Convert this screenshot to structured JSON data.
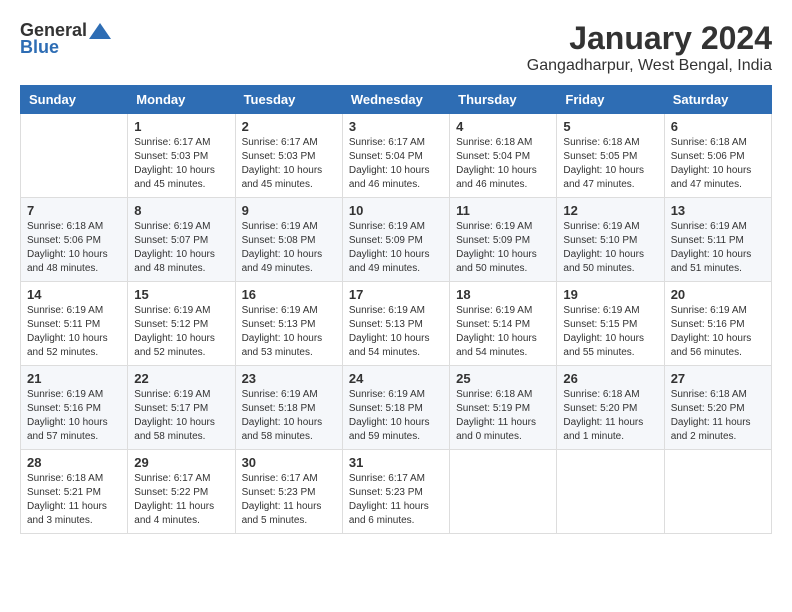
{
  "logo": {
    "general": "General",
    "blue": "Blue"
  },
  "title": "January 2024",
  "subtitle": "Gangadharpur, West Bengal, India",
  "calendar": {
    "headers": [
      "Sunday",
      "Monday",
      "Tuesday",
      "Wednesday",
      "Thursday",
      "Friday",
      "Saturday"
    ],
    "rows": [
      [
        {
          "day": "",
          "info": ""
        },
        {
          "day": "1",
          "info": "Sunrise: 6:17 AM\nSunset: 5:03 PM\nDaylight: 10 hours\nand 45 minutes."
        },
        {
          "day": "2",
          "info": "Sunrise: 6:17 AM\nSunset: 5:03 PM\nDaylight: 10 hours\nand 45 minutes."
        },
        {
          "day": "3",
          "info": "Sunrise: 6:17 AM\nSunset: 5:04 PM\nDaylight: 10 hours\nand 46 minutes."
        },
        {
          "day": "4",
          "info": "Sunrise: 6:18 AM\nSunset: 5:04 PM\nDaylight: 10 hours\nand 46 minutes."
        },
        {
          "day": "5",
          "info": "Sunrise: 6:18 AM\nSunset: 5:05 PM\nDaylight: 10 hours\nand 47 minutes."
        },
        {
          "day": "6",
          "info": "Sunrise: 6:18 AM\nSunset: 5:06 PM\nDaylight: 10 hours\nand 47 minutes."
        }
      ],
      [
        {
          "day": "7",
          "info": "Sunrise: 6:18 AM\nSunset: 5:06 PM\nDaylight: 10 hours\nand 48 minutes."
        },
        {
          "day": "8",
          "info": "Sunrise: 6:19 AM\nSunset: 5:07 PM\nDaylight: 10 hours\nand 48 minutes."
        },
        {
          "day": "9",
          "info": "Sunrise: 6:19 AM\nSunset: 5:08 PM\nDaylight: 10 hours\nand 49 minutes."
        },
        {
          "day": "10",
          "info": "Sunrise: 6:19 AM\nSunset: 5:09 PM\nDaylight: 10 hours\nand 49 minutes."
        },
        {
          "day": "11",
          "info": "Sunrise: 6:19 AM\nSunset: 5:09 PM\nDaylight: 10 hours\nand 50 minutes."
        },
        {
          "day": "12",
          "info": "Sunrise: 6:19 AM\nSunset: 5:10 PM\nDaylight: 10 hours\nand 50 minutes."
        },
        {
          "day": "13",
          "info": "Sunrise: 6:19 AM\nSunset: 5:11 PM\nDaylight: 10 hours\nand 51 minutes."
        }
      ],
      [
        {
          "day": "14",
          "info": "Sunrise: 6:19 AM\nSunset: 5:11 PM\nDaylight: 10 hours\nand 52 minutes."
        },
        {
          "day": "15",
          "info": "Sunrise: 6:19 AM\nSunset: 5:12 PM\nDaylight: 10 hours\nand 52 minutes."
        },
        {
          "day": "16",
          "info": "Sunrise: 6:19 AM\nSunset: 5:13 PM\nDaylight: 10 hours\nand 53 minutes."
        },
        {
          "day": "17",
          "info": "Sunrise: 6:19 AM\nSunset: 5:13 PM\nDaylight: 10 hours\nand 54 minutes."
        },
        {
          "day": "18",
          "info": "Sunrise: 6:19 AM\nSunset: 5:14 PM\nDaylight: 10 hours\nand 54 minutes."
        },
        {
          "day": "19",
          "info": "Sunrise: 6:19 AM\nSunset: 5:15 PM\nDaylight: 10 hours\nand 55 minutes."
        },
        {
          "day": "20",
          "info": "Sunrise: 6:19 AM\nSunset: 5:16 PM\nDaylight: 10 hours\nand 56 minutes."
        }
      ],
      [
        {
          "day": "21",
          "info": "Sunrise: 6:19 AM\nSunset: 5:16 PM\nDaylight: 10 hours\nand 57 minutes."
        },
        {
          "day": "22",
          "info": "Sunrise: 6:19 AM\nSunset: 5:17 PM\nDaylight: 10 hours\nand 58 minutes."
        },
        {
          "day": "23",
          "info": "Sunrise: 6:19 AM\nSunset: 5:18 PM\nDaylight: 10 hours\nand 58 minutes."
        },
        {
          "day": "24",
          "info": "Sunrise: 6:19 AM\nSunset: 5:18 PM\nDaylight: 10 hours\nand 59 minutes."
        },
        {
          "day": "25",
          "info": "Sunrise: 6:18 AM\nSunset: 5:19 PM\nDaylight: 11 hours\nand 0 minutes."
        },
        {
          "day": "26",
          "info": "Sunrise: 6:18 AM\nSunset: 5:20 PM\nDaylight: 11 hours\nand 1 minute."
        },
        {
          "day": "27",
          "info": "Sunrise: 6:18 AM\nSunset: 5:20 PM\nDaylight: 11 hours\nand 2 minutes."
        }
      ],
      [
        {
          "day": "28",
          "info": "Sunrise: 6:18 AM\nSunset: 5:21 PM\nDaylight: 11 hours\nand 3 minutes."
        },
        {
          "day": "29",
          "info": "Sunrise: 6:17 AM\nSunset: 5:22 PM\nDaylight: 11 hours\nand 4 minutes."
        },
        {
          "day": "30",
          "info": "Sunrise: 6:17 AM\nSunset: 5:23 PM\nDaylight: 11 hours\nand 5 minutes."
        },
        {
          "day": "31",
          "info": "Sunrise: 6:17 AM\nSunset: 5:23 PM\nDaylight: 11 hours\nand 6 minutes."
        },
        {
          "day": "",
          "info": ""
        },
        {
          "day": "",
          "info": ""
        },
        {
          "day": "",
          "info": ""
        }
      ]
    ]
  }
}
